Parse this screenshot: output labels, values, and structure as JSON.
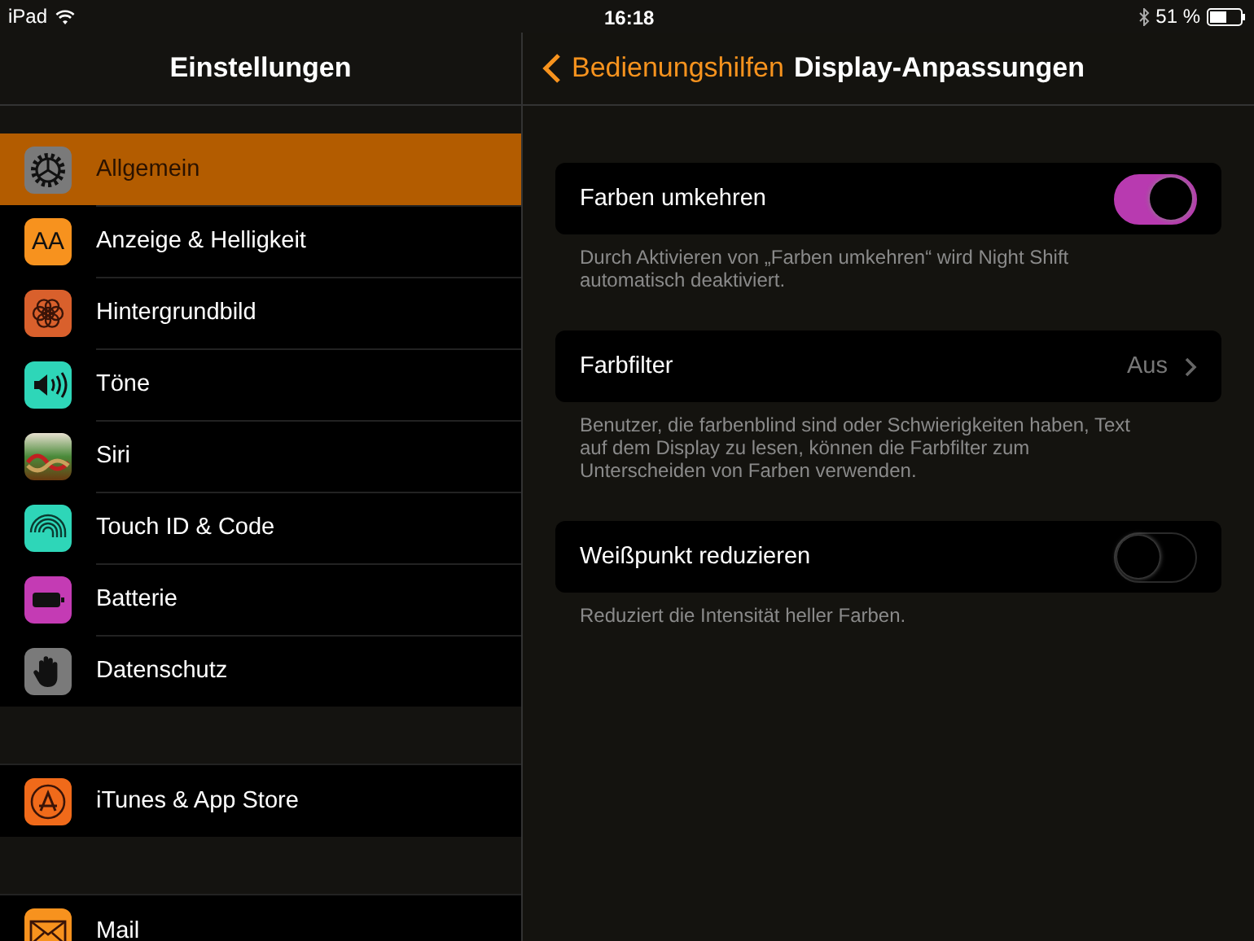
{
  "status_bar": {
    "device": "iPad",
    "time": "16:18",
    "battery": "51 %"
  },
  "sidebar": {
    "title": "Einstellungen",
    "groups": [
      {
        "items": [
          {
            "label": "Allgemein",
            "kind": "gear",
            "color": "#7a7a7a",
            "selected": true
          },
          {
            "label": "Anzeige & Helligkeit",
            "kind": "letters",
            "icon_text": "AA",
            "color": "#f7921e",
            "selected": false
          },
          {
            "label": "Hintergrundbild",
            "kind": "flower",
            "color": "#d9602c",
            "selected": false
          },
          {
            "label": "Töne",
            "kind": "speaker",
            "color": "#2ed6b8",
            "selected": false
          },
          {
            "label": "Siri",
            "kind": "siri",
            "selected": false
          },
          {
            "label": "Touch ID & Code",
            "kind": "fingerprint",
            "color": "#2ed6b8",
            "selected": false
          },
          {
            "label": "Batterie",
            "kind": "battery",
            "color": "#c43bb4",
            "selected": false
          },
          {
            "label": "Datenschutz",
            "kind": "hand",
            "color": "#7a7a7a",
            "selected": false
          }
        ]
      },
      {
        "items": [
          {
            "label": "iTunes & App Store",
            "kind": "appstore",
            "color": "#f06a1a",
            "selected": false
          }
        ]
      },
      {
        "items": [
          {
            "label": "Mail",
            "kind": "mail",
            "color": "#f7921e",
            "selected": false
          }
        ]
      }
    ]
  },
  "detail": {
    "back": "Bedienungshilfen",
    "title": "Display-Anpassungen",
    "sections": [
      {
        "kind": "toggle",
        "label": "Farben umkehren",
        "on": true,
        "footer": "Durch Aktivieren von „Farben umkehren“ wird Night Shift automatisch deaktiviert."
      },
      {
        "kind": "disclosure",
        "label": "Farbfilter",
        "value": "Aus",
        "footer": "Benutzer, die farbenblind sind oder Schwierigkeiten haben, Text auf dem Display zu lesen, können die Farbfilter zum Unterscheiden von Farben verwenden."
      },
      {
        "kind": "toggle",
        "label": "Weißpunkt reduzieren",
        "on": false,
        "footer": "Reduziert die Intensität heller Farben."
      }
    ]
  }
}
